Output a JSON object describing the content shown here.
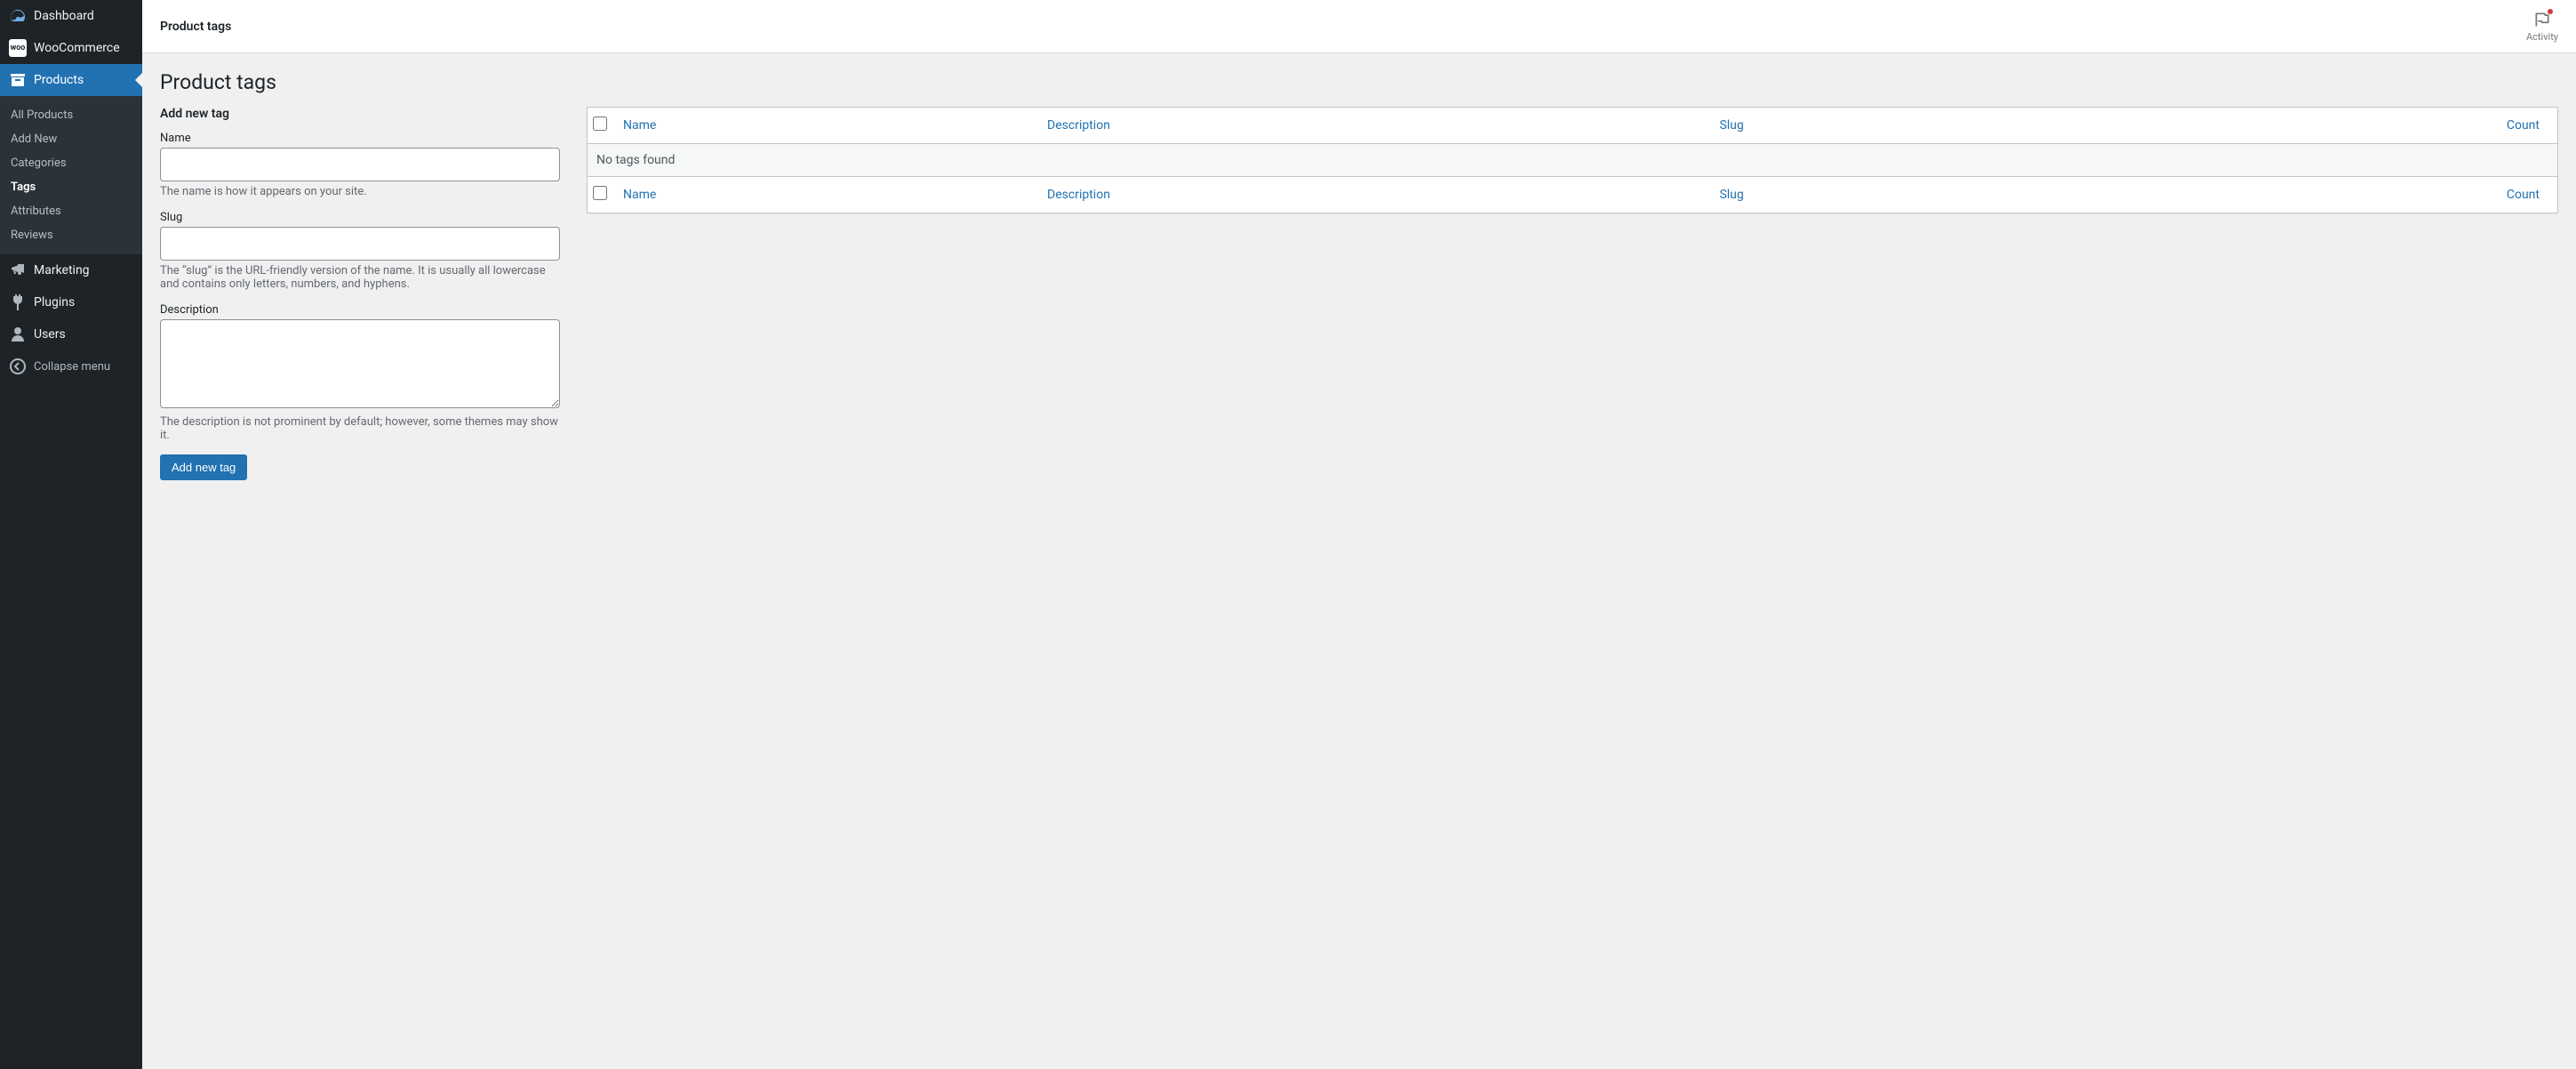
{
  "sidebar": {
    "dashboard": "Dashboard",
    "woocommerce": "WooCommerce",
    "products": "Products",
    "submenu": {
      "all_products": "All Products",
      "add_new": "Add New",
      "categories": "Categories",
      "tags": "Tags",
      "attributes": "Attributes",
      "reviews": "Reviews"
    },
    "marketing": "Marketing",
    "plugins": "Plugins",
    "users": "Users",
    "collapse": "Collapse menu"
  },
  "topbar": {
    "title": "Product tags",
    "activity": "Activity"
  },
  "page": {
    "heading": "Product tags"
  },
  "form": {
    "section_title": "Add new tag",
    "name": {
      "label": "Name",
      "value": "",
      "help": "The name is how it appears on your site."
    },
    "slug": {
      "label": "Slug",
      "value": "",
      "help": "The “slug” is the URL-friendly version of the name. It is usually all lowercase and contains only letters, numbers, and hyphens."
    },
    "description": {
      "label": "Description",
      "value": "",
      "help": "The description is not prominent by default; however, some themes may show it."
    },
    "submit": "Add new tag"
  },
  "table": {
    "columns": {
      "name": "Name",
      "description": "Description",
      "slug": "Slug",
      "count": "Count"
    },
    "empty": "No tags found"
  }
}
